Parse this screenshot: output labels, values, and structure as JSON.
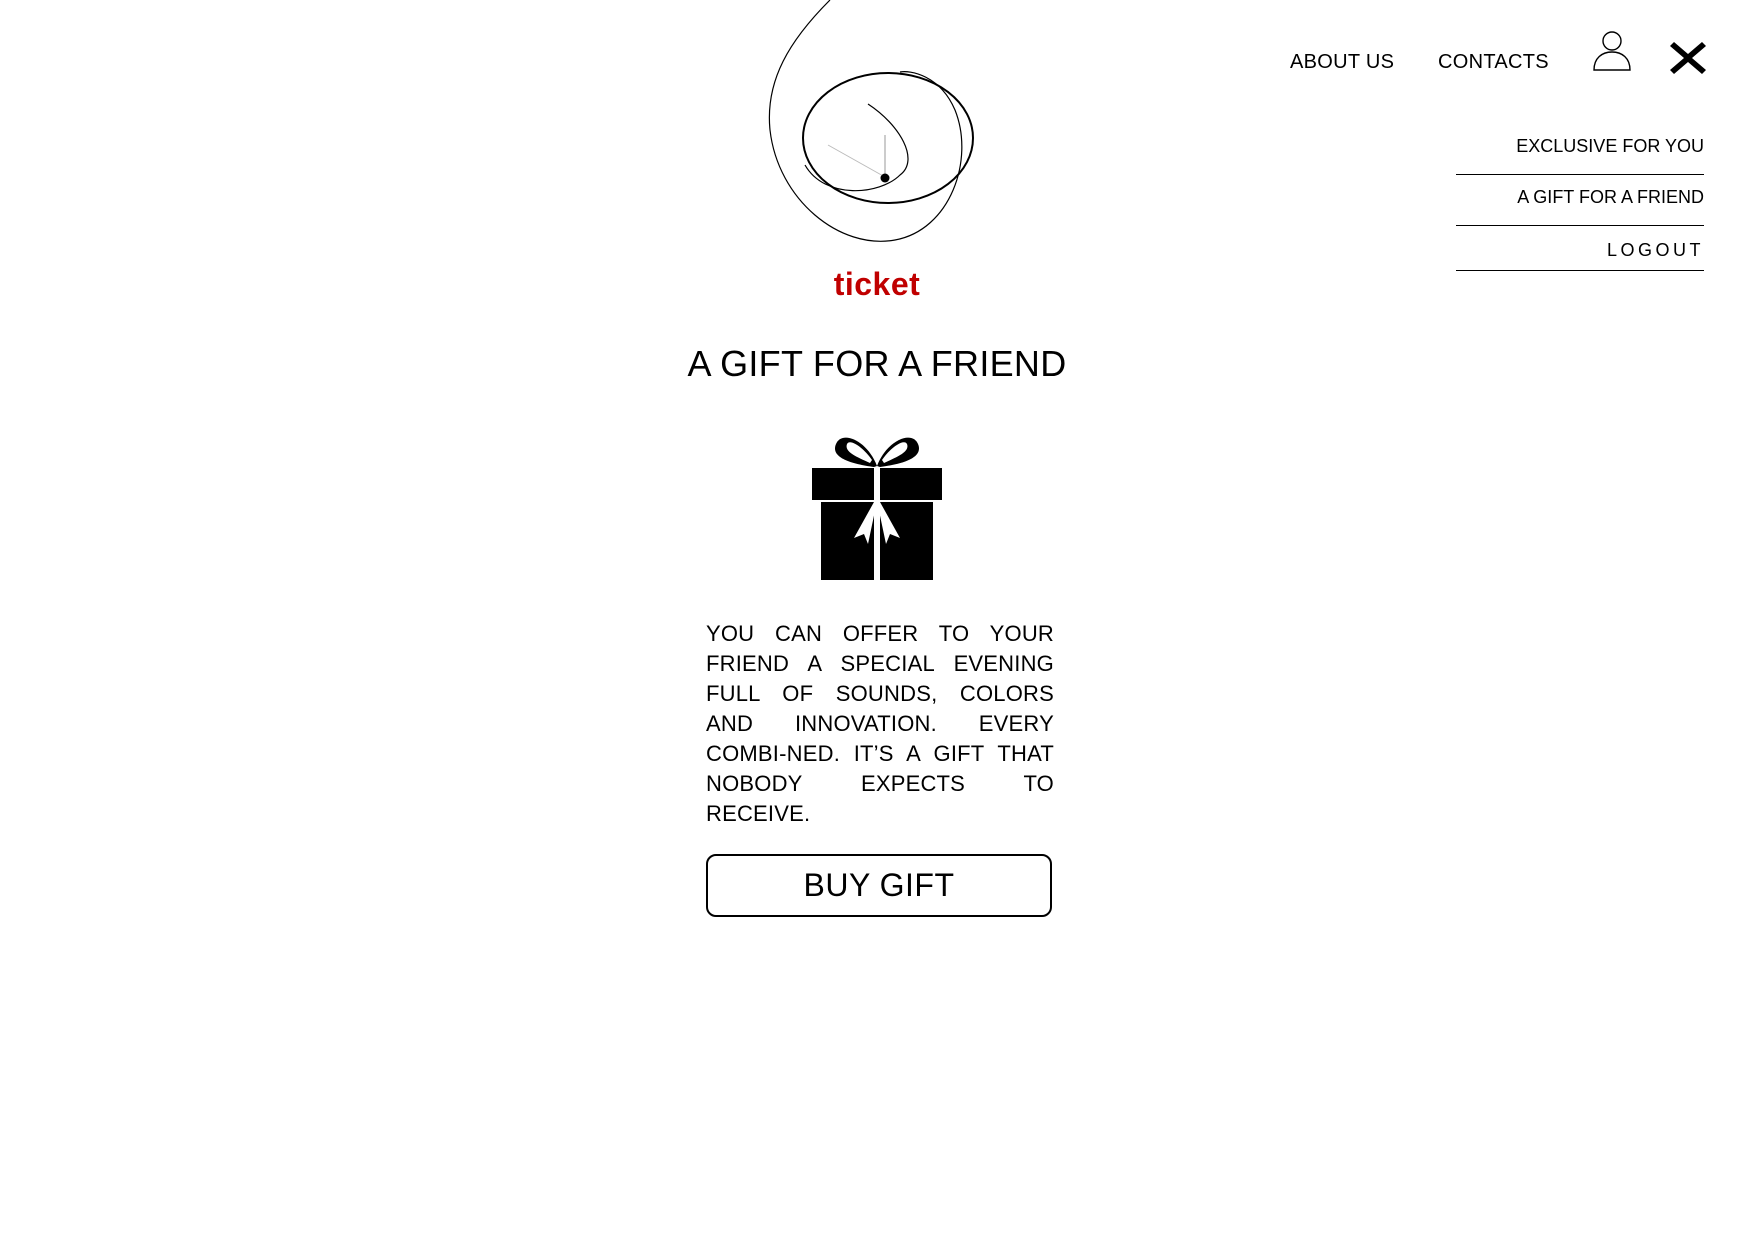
{
  "header": {
    "nav": {
      "about_label": "ABOUT US",
      "contacts_label": "CONTACTS"
    },
    "user_icon": "user-outline-icon",
    "close_icon": "close-x-icon"
  },
  "dropdown": {
    "items": [
      {
        "label": "EXCLUSIVE FOR YOU"
      },
      {
        "label": "A GIFT FOR A FRIEND"
      },
      {
        "label": "LOGOUT"
      }
    ]
  },
  "brand": {
    "name": "ticket",
    "color": "#c00000",
    "logo_icon": "swirl-logo-icon"
  },
  "main": {
    "title": "A GIFT FOR A FRIEND",
    "gift_icon": "gift-box-icon",
    "description": "YOU CAN OFFER TO YOUR FRIEND A SPECIAL EVENING FULL OF SOUNDS, COLORS AND INNOVATION. EVERY COMBI-NED. IT’S A GIFT THAT NOBODY EXPECTS TO RECEIVE.",
    "button_label": "BUY GIFT"
  }
}
